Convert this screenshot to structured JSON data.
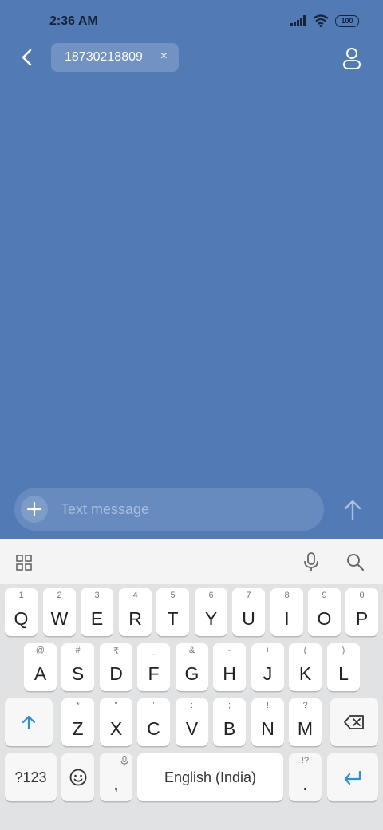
{
  "status_bar": {
    "time": "2:36 AM",
    "battery": "100"
  },
  "header": {
    "recipient": "18730218809",
    "remove_symbol": "×"
  },
  "composer": {
    "placeholder": "Text message"
  },
  "keyboard": {
    "row1": [
      {
        "key": "Q",
        "alt": "1"
      },
      {
        "key": "W",
        "alt": "2"
      },
      {
        "key": "E",
        "alt": "3"
      },
      {
        "key": "R",
        "alt": "4"
      },
      {
        "key": "T",
        "alt": "5"
      },
      {
        "key": "Y",
        "alt": "6"
      },
      {
        "key": "U",
        "alt": "7"
      },
      {
        "key": "I",
        "alt": "8"
      },
      {
        "key": "O",
        "alt": "9"
      },
      {
        "key": "P",
        "alt": "0"
      }
    ],
    "row2": [
      {
        "key": "A",
        "alt": "@"
      },
      {
        "key": "S",
        "alt": "#"
      },
      {
        "key": "D",
        "alt": "₹"
      },
      {
        "key": "F",
        "alt": "_"
      },
      {
        "key": "G",
        "alt": "&"
      },
      {
        "key": "H",
        "alt": "-"
      },
      {
        "key": "J",
        "alt": "+"
      },
      {
        "key": "K",
        "alt": "("
      },
      {
        "key": "L",
        "alt": ")"
      }
    ],
    "row3": [
      {
        "key": "Z",
        "alt": "*"
      },
      {
        "key": "X",
        "alt": "\""
      },
      {
        "key": "C",
        "alt": "'"
      },
      {
        "key": "V",
        "alt": ":"
      },
      {
        "key": "B",
        "alt": ";"
      },
      {
        "key": "N",
        "alt": "!"
      },
      {
        "key": "M",
        "alt": "?"
      }
    ],
    "symbols_label": "?123",
    "comma": ",",
    "space_label": "English (India)",
    "period": ".",
    "period_alt": "!?",
    "accent_color": "#2a8fd8"
  }
}
